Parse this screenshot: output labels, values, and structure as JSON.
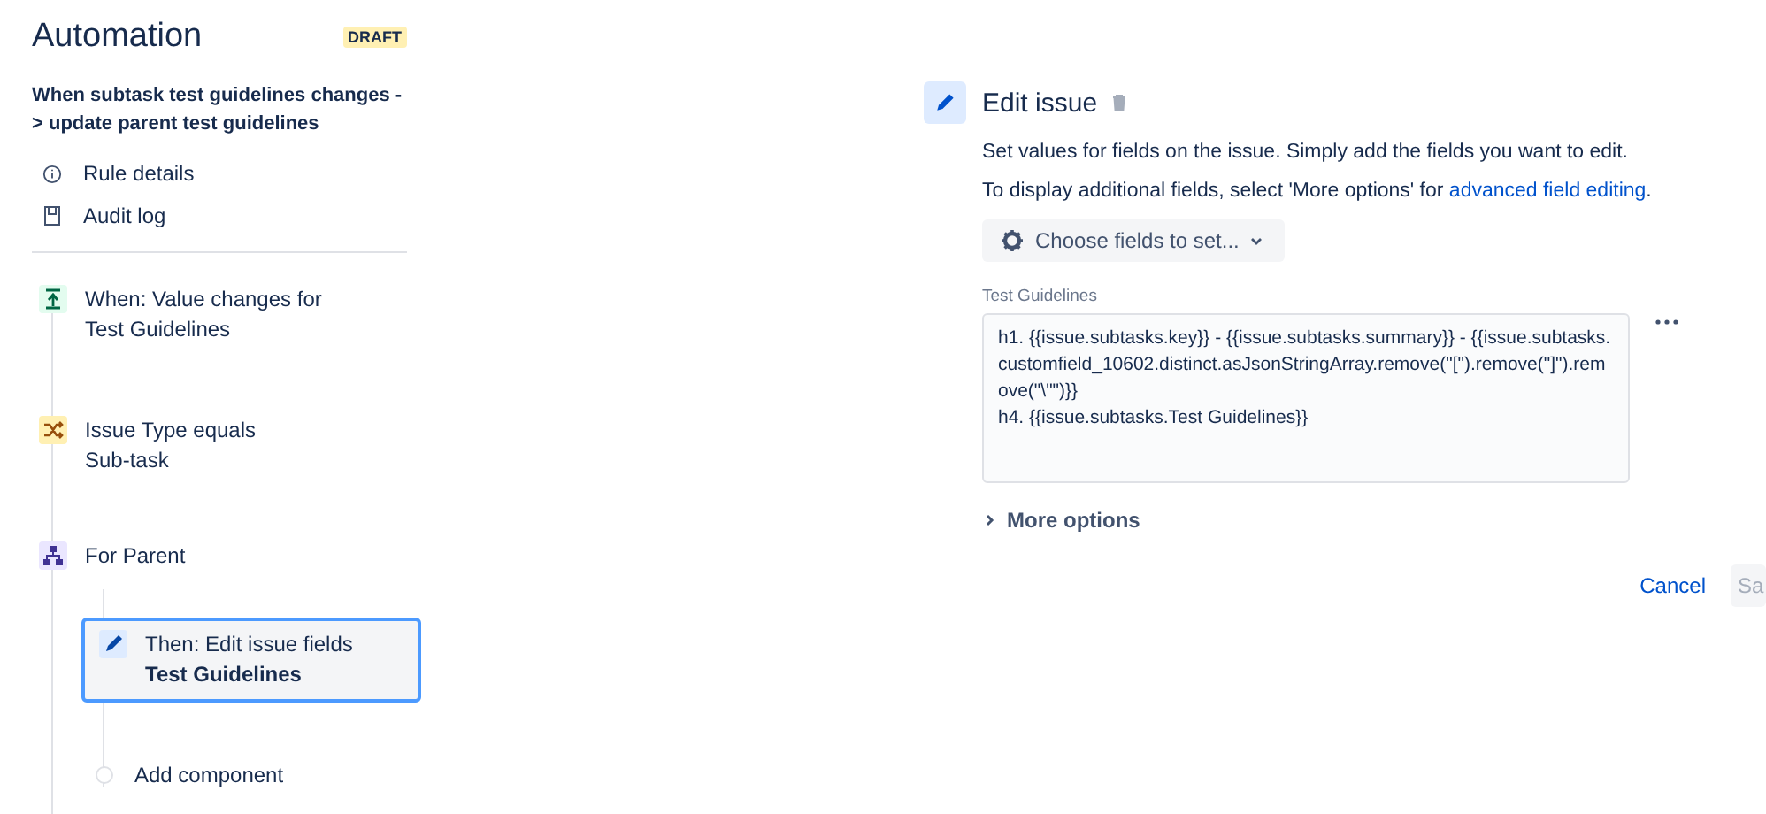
{
  "sidebar": {
    "title": "Automation",
    "badge": "DRAFT",
    "rule_name": "When subtask test guidelines changes -> update parent test guidelines",
    "links": [
      {
        "kind": "info",
        "label": "Rule details"
      },
      {
        "kind": "log",
        "label": "Audit log"
      }
    ],
    "steps": [
      {
        "kind": "trigger",
        "title": "When: Value changes for",
        "subtitle": "Test Guidelines"
      },
      {
        "kind": "condition",
        "title": "Issue Type equals",
        "subtitle": "Sub-task"
      },
      {
        "kind": "branch",
        "title": "For Parent",
        "children": [
          {
            "kind": "action",
            "title": "Then: Edit issue fields",
            "subtitle": "Test Guidelines",
            "selected": true
          },
          {
            "kind": "add",
            "title": "Add component"
          }
        ]
      }
    ]
  },
  "editor": {
    "title": "Edit issue",
    "description": "Set values for fields on the issue. Simply add the fields you want to edit.",
    "hint": "To display additional fields, select 'More options' for ",
    "hint_link": "advanced field editing",
    "hint_end": ".",
    "choose_button": "Choose fields to set...",
    "field": {
      "label": "Test Guidelines",
      "value": "h1. {{issue.subtasks.key}} - {{issue.subtasks.summary}} - {{issue.subtasks.customfield_10602.distinct.asJsonStringArray.remove(\"[\").remove(\"]\").remove(\"\\\"\")}}\nh4. {{issue.subtasks.Test Guidelines}}"
    },
    "more_options": {
      "label": "More options",
      "expanded": false
    },
    "buttons": [
      {
        "kind": "cancel",
        "label": "Cancel"
      },
      {
        "kind": "save",
        "label": "Sa"
      }
    ]
  }
}
